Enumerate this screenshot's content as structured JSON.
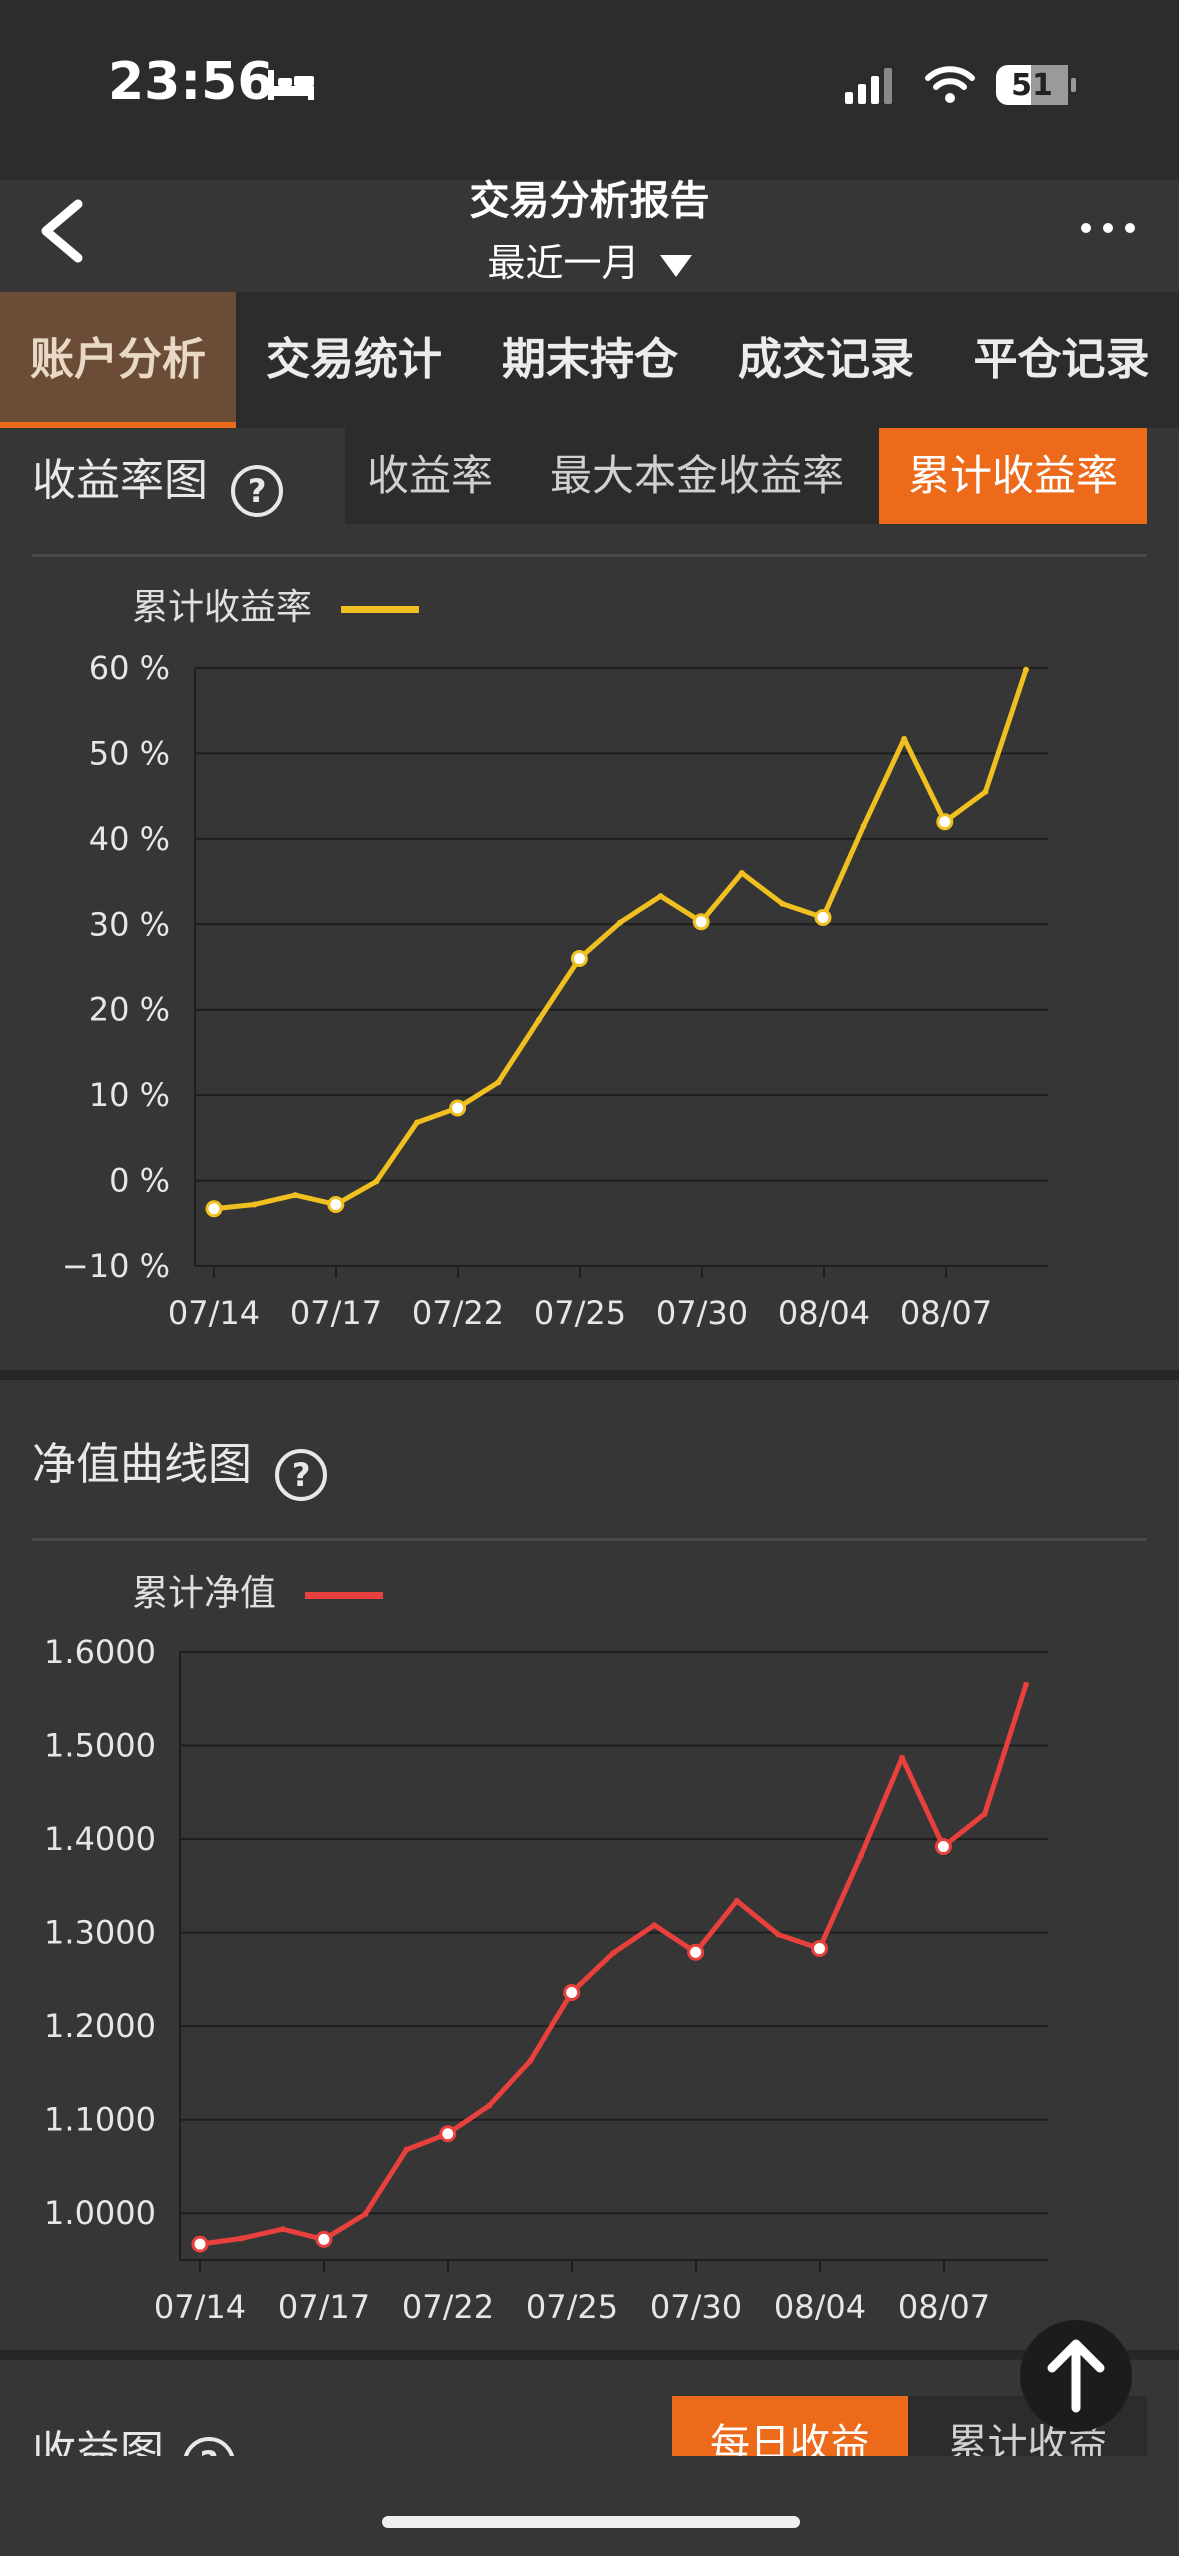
{
  "status_bar": {
    "time": "23:56",
    "battery": "51"
  },
  "nav": {
    "title": "交易分析报告",
    "subtitle": "最近一月",
    "back_icon": "chevron-left-icon",
    "more_icon": "more-icon"
  },
  "tabs": [
    "账户分析",
    "交易统计",
    "期末持仓",
    "成交记录",
    "平仓记录"
  ],
  "return_section": {
    "title": "收益率图",
    "segments": [
      "收益率",
      "最大本金收益率",
      "累计收益率"
    ],
    "active_segment": 2,
    "legend": "累计收益率",
    "color": "#f0c020"
  },
  "nav_section": {
    "title": "净值曲线图",
    "legend": "累计净值",
    "color": "#e8403c"
  },
  "bottom_section": {
    "title": "收益图",
    "segments": [
      "每日收益",
      "累计收益"
    ],
    "active_segment": 0
  },
  "chart_data": [
    {
      "type": "line",
      "series": [
        {
          "name": "累计收益率",
          "values": [
            -3.3,
            -2.8,
            -1.7,
            -2.8,
            -0.1,
            6.8,
            8.5,
            11.5,
            18.8,
            26.0,
            30.2,
            33.3,
            30.3,
            36.0,
            32.4,
            30.8,
            41.5,
            51.7,
            42.0,
            45.5,
            59.8
          ]
        }
      ],
      "x_tick_labels": [
        "07/14",
        "07/17",
        "07/22",
        "07/25",
        "07/30",
        "08/04",
        "08/07"
      ],
      "y_tick_labels": [
        "60 %",
        "50 %",
        "40 %",
        "30 %",
        "20 %",
        "10 %",
        "0 %",
        "−10 %"
      ],
      "ylim": [
        -10,
        60
      ],
      "marked_points": [
        0,
        3,
        6,
        9,
        12,
        15,
        18
      ],
      "grid": true,
      "legend": "top-left"
    },
    {
      "type": "line",
      "series": [
        {
          "name": "累计净值",
          "values": [
            0.967,
            0.973,
            0.983,
            0.972,
            0.999,
            1.068,
            1.085,
            1.115,
            1.163,
            1.236,
            1.278,
            1.308,
            1.279,
            1.334,
            1.298,
            1.283,
            1.382,
            1.487,
            1.392,
            1.427,
            1.565
          ]
        }
      ],
      "x_tick_labels": [
        "07/14",
        "07/17",
        "07/22",
        "07/25",
        "07/30",
        "08/04",
        "08/07"
      ],
      "y_tick_labels": [
        "1.6000",
        "1.5000",
        "1.4000",
        "1.3000",
        "1.2000",
        "1.1000",
        "1.0000"
      ],
      "ylim": [
        0.95,
        1.6
      ],
      "marked_points": [
        0,
        3,
        6,
        9,
        12,
        15,
        18
      ],
      "grid": true,
      "legend": "top-left"
    }
  ]
}
